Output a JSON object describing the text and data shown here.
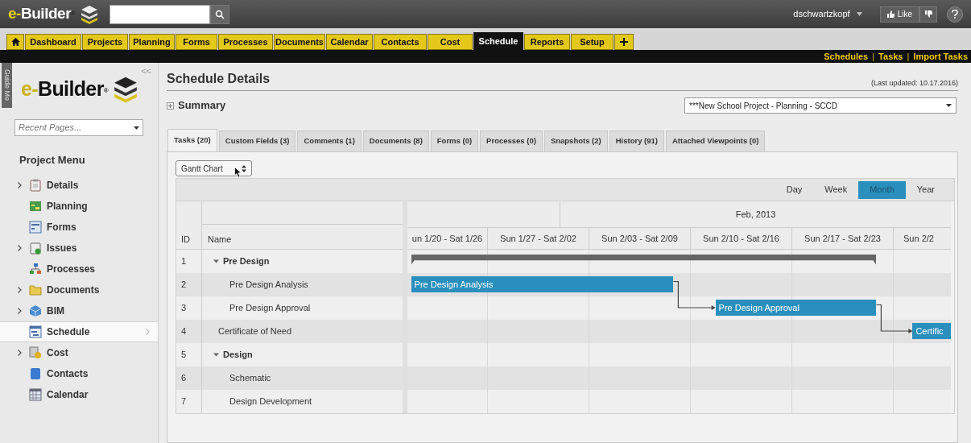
{
  "top_bar": {
    "logo": {
      "prefix": "e-",
      "name": "Builder",
      "mark": "®"
    },
    "user": "dschwartzkopf",
    "like": "Like"
  },
  "nav_tabs": [
    {
      "label": "Dashboard",
      "selected": false
    },
    {
      "label": "Projects",
      "selected": false
    },
    {
      "label": "Planning",
      "selected": false
    },
    {
      "label": "Forms",
      "selected": false
    },
    {
      "label": "Processes",
      "selected": false
    },
    {
      "label": "Documents",
      "selected": false
    },
    {
      "label": "Calendar",
      "selected": false
    },
    {
      "label": "Contacts",
      "selected": false
    },
    {
      "label": "Cost",
      "selected": false
    },
    {
      "label": "Schedule",
      "selected": true
    },
    {
      "label": "Reports",
      "selected": false
    },
    {
      "label": "Setup",
      "selected": false
    }
  ],
  "sub_links": [
    {
      "kind": "link",
      "label": "Schedules"
    },
    {
      "kind": "separator",
      "label": "|"
    },
    {
      "kind": "link",
      "label": "Tasks"
    },
    {
      "kind": "separator",
      "label": "|"
    },
    {
      "kind": "link",
      "label": "Import Tasks"
    }
  ],
  "sidebar": {
    "collapse": "<<",
    "guide": "Guide Me",
    "logo": {
      "prefix": "e-",
      "name": "Builder",
      "mark": "®"
    },
    "recent_pages": {
      "placeholder": "Recent Pages..."
    },
    "menu_title": "Project Menu",
    "items": [
      {
        "label": "Details",
        "expandable": true,
        "selected": false
      },
      {
        "label": "Planning",
        "expandable": false,
        "selected": false
      },
      {
        "label": "Forms",
        "expandable": false,
        "selected": false
      },
      {
        "label": "Issues",
        "expandable": true,
        "selected": false
      },
      {
        "label": "Processes",
        "expandable": false,
        "selected": false
      },
      {
        "label": "Documents",
        "expandable": true,
        "selected": false
      },
      {
        "label": "BIM",
        "expandable": true,
        "selected": false
      },
      {
        "label": "Schedule",
        "expandable": false,
        "selected": true
      },
      {
        "label": "Cost",
        "expandable": true,
        "selected": false
      },
      {
        "label": "Contacts",
        "expandable": false,
        "selected": false
      },
      {
        "label": "Calendar",
        "expandable": false,
        "selected": false
      }
    ]
  },
  "page": {
    "title": "Schedule Details",
    "last_updated": "(Last updated: 10.17.2016)",
    "summary": "Summary",
    "project": "***New School Project - Planning - SCCD"
  },
  "tabs": [
    {
      "label": "Tasks (20)",
      "selected": true
    },
    {
      "label": "Custom Fields (3)",
      "selected": false
    },
    {
      "label": "Comments (1)",
      "selected": false
    },
    {
      "label": "Documents (8)",
      "selected": false
    },
    {
      "label": "Forms (0)",
      "selected": false
    },
    {
      "label": "Processes (0)",
      "selected": false
    },
    {
      "label": "Snapshots (2)",
      "selected": false
    },
    {
      "label": "History (91)",
      "selected": false
    },
    {
      "label": "Attached Viewpoints (0)",
      "selected": false
    }
  ],
  "gantt": {
    "view": "Gantt Chart",
    "scales": [
      {
        "label": "Day",
        "selected": false
      },
      {
        "label": "Week",
        "selected": false
      },
      {
        "label": "Month",
        "selected": true
      },
      {
        "label": "Year",
        "selected": false
      }
    ],
    "columns": [
      "ID",
      "Name"
    ],
    "month": "Feb, 2013",
    "weeks": [
      "un 1/20 - Sat 1/26",
      "Sun 1/27 - Sat 2/02",
      "Sun 2/03 - Sat 2/09",
      "Sun 2/10 - Sat 2/16",
      "Sun 2/17 - Sat 2/23",
      "Sun 2/2"
    ],
    "tasks": [
      {
        "id": "1",
        "name": "Pre Design",
        "expanded": true,
        "bar": {
          "kind": "summary"
        },
        "children": [
          {
            "id": "2",
            "name": "Pre Design Analysis",
            "bar": {
              "kind": "task",
              "label": "Pre Design Analysis",
              "dependency": false
            }
          },
          {
            "id": "3",
            "name": "Pre Design Approval",
            "bar": {
              "kind": "task",
              "label": "Pre Design Approval",
              "dependency": true
            }
          }
        ]
      },
      {
        "id": "4",
        "name": "Certificate of Need",
        "bar": {
          "kind": "task",
          "label": "Certific",
          "dependency": true
        }
      },
      {
        "id": "5",
        "name": "Design",
        "expanded": true,
        "children": [
          {
            "id": "6",
            "name": "Schematic"
          },
          {
            "id": "7",
            "name": "Design Development"
          }
        ]
      }
    ]
  }
}
